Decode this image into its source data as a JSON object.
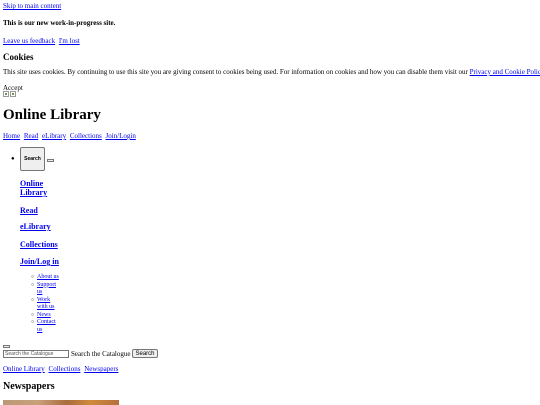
{
  "skip_link": "Skip to main content",
  "banner": {
    "wip_text": "This is our new work-in-progress site.",
    "links": [
      "Leave us feedback",
      "I'm lost"
    ]
  },
  "cookies": {
    "heading": "Cookies",
    "text": "This site uses cookies. By continuing to use this site you are giving consent to cookies being used. For information on cookies and how you can disable them visit our ",
    "policy_link": "Privacy and Cookie Policy",
    "text_end": ".",
    "accept": "Accept"
  },
  "site": {
    "title": "Online Library"
  },
  "top_nav": [
    "Home",
    "Read",
    "eLibrary",
    "Collections",
    "Join/Login"
  ],
  "menu": {
    "search_button": "Search",
    "items": [
      "Online Library",
      "Read",
      "eLibrary",
      "Collections",
      "Join/Log in"
    ],
    "sub_items": [
      "About us",
      "Support us",
      "Work with us",
      "News",
      "Contact us"
    ]
  },
  "search": {
    "placeholder": "Search the Catalogue",
    "label": "Search the Catalogue",
    "button": "Search"
  },
  "breadcrumbs": [
    "Online Library",
    "Collections",
    "Newspapers"
  ],
  "page_title": "Newspapers"
}
